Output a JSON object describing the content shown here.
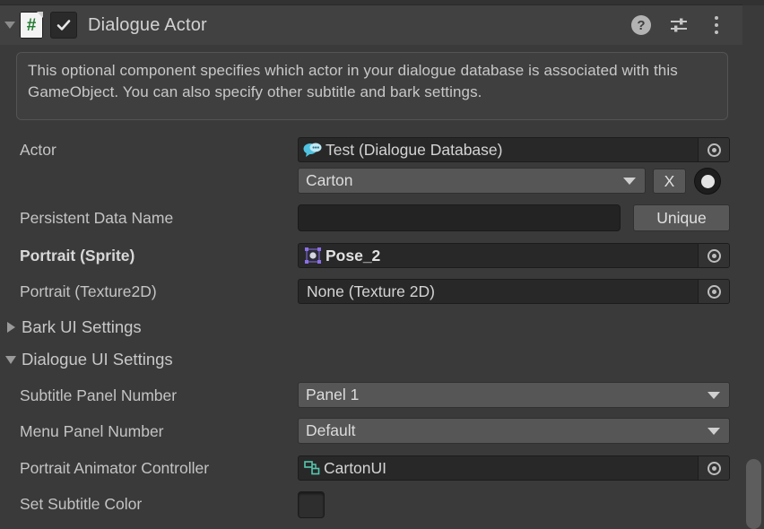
{
  "component": {
    "title": "Dialogue Actor",
    "enabled": true,
    "expanded": true,
    "script_icon": "csharp-script-icon",
    "script_glyph": "#",
    "header_icons": [
      {
        "name": "help-icon",
        "glyph": "?"
      },
      {
        "name": "preset-icon",
        "glyph": "sliders"
      },
      {
        "name": "more-menu-icon",
        "glyph": "kebab"
      }
    ]
  },
  "help_box": {
    "text": "This optional component specifies which actor in your dialogue database is associated with this GameObject. You can also specify other subtitle and bark settings."
  },
  "fields": {
    "actor": {
      "label": "Actor",
      "object_value": "Test (Dialogue Database)",
      "object_icon": "dialogue-database-icon",
      "dropdown_value": "Carton",
      "clear_button": "X",
      "select_button": "object-select-toggle"
    },
    "persistent_data_name": {
      "label": "Persistent Data Name",
      "value": "",
      "button": "Unique"
    },
    "portrait_sprite": {
      "label": "Portrait (Sprite)",
      "value": "Pose_2",
      "icon": "sprite-icon",
      "bold": true
    },
    "portrait_texture2d": {
      "label": "Portrait (Texture2D)",
      "value": "None (Texture 2D)",
      "bold": false
    }
  },
  "sections": [
    {
      "name": "bark-ui-settings",
      "label": "Bark UI Settings",
      "expanded": false
    },
    {
      "name": "dialogue-ui-settings",
      "label": "Dialogue UI Settings",
      "expanded": true
    }
  ],
  "dialogue_ui_settings": {
    "subtitle_panel_number": {
      "label": "Subtitle Panel Number",
      "value": "Panel 1"
    },
    "menu_panel_number": {
      "label": "Menu Panel Number",
      "value": "Default"
    },
    "portrait_animator_controller": {
      "label": "Portrait Animator Controller",
      "value": "CartonUI",
      "icon": "animator-controller-icon"
    },
    "set_subtitle_color": {
      "label": "Set Subtitle Color",
      "checked": false
    }
  },
  "colors": {
    "window_bg": "#3a3a3a",
    "header_bg": "#414141",
    "object_field_bg": "#282828",
    "dropdown_bg": "#565656",
    "text": "#c4c4c4",
    "accent_sprite": "#8b6fe8",
    "accent_dialogue": "#5fc8e8",
    "accent_animator": "#55c8b0",
    "script_green": "#1f7a2e"
  }
}
